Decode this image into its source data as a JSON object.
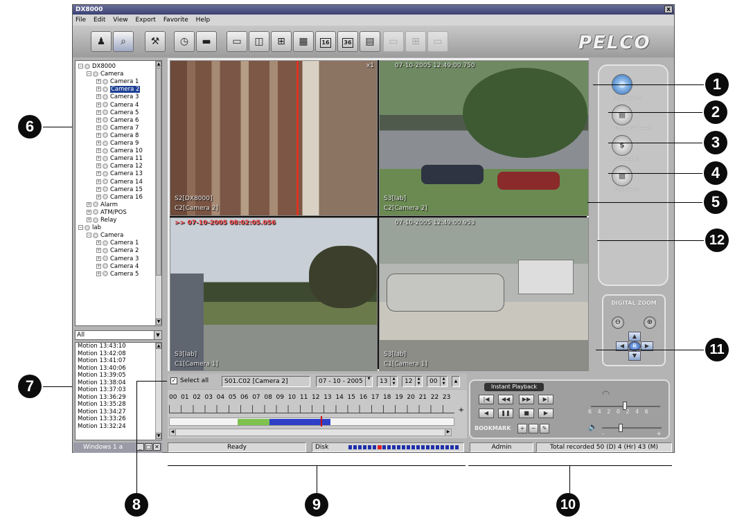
{
  "window": {
    "title": "DX8000",
    "close": "x"
  },
  "menu": [
    "File",
    "Edit",
    "View",
    "Export",
    "Favorite",
    "Help"
  ],
  "toolbar": {
    "buttons": [
      "person-icon",
      "search-icon",
      "tools-icon",
      "clock-icon",
      "printer-icon",
      "layout-1-icon",
      "layout-2-icon",
      "layout-4-icon",
      "layout-9-icon",
      "layout-16-icon",
      "layout-36-icon",
      "layout-multi-icon",
      "layout-a-icon",
      "layout-b-icon",
      "layout-c-icon"
    ],
    "sixteen": "16",
    "thirtysix": "36",
    "logo": "PELCO"
  },
  "tree": {
    "root": "DX8000",
    "camera_group": "Camera",
    "cameras": [
      "Camera 1",
      "Camera 2",
      "Camera 3",
      "Camera 4",
      "Camera 5",
      "Camera 6",
      "Camera 7",
      "Camera 8",
      "Camera 9",
      "Camera 10",
      "Camera 11",
      "Camera 12",
      "Camera 13",
      "Camera 14",
      "Camera 15",
      "Camera 16"
    ],
    "selected": "Camera 2",
    "alarm": "Alarm",
    "atm": "ATM/POS",
    "relay": "Relay",
    "lab": "lab",
    "lab_camera_group": "Camera",
    "lab_cameras": [
      "Camera 1",
      "Camera 2",
      "Camera 3",
      "Camera 4",
      "Camera 5"
    ]
  },
  "event_filter": "All",
  "event_log": [
    "Motion 13:43:10",
    "Motion 13:42:08",
    "Motion 13:41:07",
    "Motion 13:40:06",
    "Motion 13:39:05",
    "Motion 13:38:04",
    "Motion 13:37:03",
    "Motion 13:36:29",
    "Motion 13:35:28",
    "Motion 13:34:27",
    "Motion 13:33:26",
    "Motion 13:32:24"
  ],
  "taskbar": {
    "label": "Windows 1 a"
  },
  "video": {
    "c1": {
      "zoom": "x1",
      "site": "S2[DX8000]",
      "cam": "C2[Camera 2]"
    },
    "c2": {
      "time": "07-10-2005 12:49:00.750",
      "site": "S3[lab]",
      "cam": "C2[Camera 2]"
    },
    "c3": {
      "time": ">> 07-10-2005 08:02:05.056",
      "site": "S3[lab]",
      "cam": "C1[Camera 1]"
    },
    "c4": {
      "time": "07-10-2005 12:49:00.953",
      "site": "S3[lab]",
      "cam": "C1[Camera 1]"
    }
  },
  "search_buttons": [
    {
      "label": "Index Search"
    },
    {
      "label": "Thumbnail Search"
    },
    {
      "label": "POS Search"
    },
    {
      "label": "Pixel Search"
    }
  ],
  "digital_zoom": {
    "title": "DIGITAL ZOOM",
    "center": "R"
  },
  "controls": {
    "check": "✓",
    "select_all": "Select all",
    "camera": "S01.C02 [Camera 2]",
    "date": "07 - 10 - 2005",
    "hour": "13",
    "minute": "12",
    "second": "00"
  },
  "hours": [
    "00",
    "01",
    "02",
    "03",
    "04",
    "05",
    "06",
    "07",
    "08",
    "09",
    "10",
    "11",
    "12",
    "13",
    "14",
    "15",
    "16",
    "17",
    "18",
    "19",
    "20",
    "21",
    "22",
    "23"
  ],
  "status": {
    "ready": "Ready",
    "disk": "Disk",
    "user": "Admin",
    "recorded": "Total recorded 50 (D) 4 (Hr) 43 (M)"
  },
  "playback": {
    "title": "Instant Playback",
    "bookmark": "BOOKMARK",
    "speed_scale": "6 4 2 0 2 4 6",
    "vol_minus": "-",
    "vol_plus": "+"
  },
  "markers": [
    "1",
    "2",
    "3",
    "4",
    "5",
    "6",
    "7",
    "8",
    "9",
    "10",
    "11",
    "12"
  ]
}
